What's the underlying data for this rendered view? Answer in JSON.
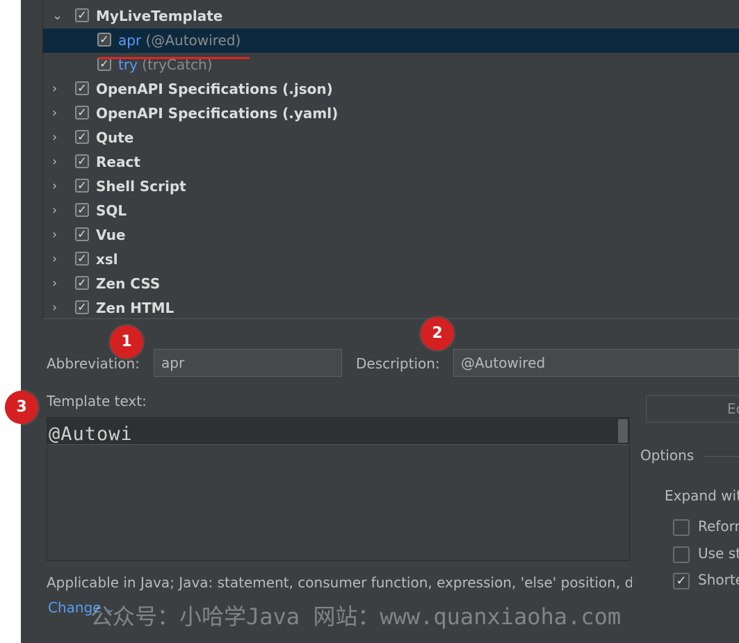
{
  "tree": {
    "rows": [
      {
        "label": "MyLiveTemplate",
        "checked": true,
        "expanded": true
      },
      {
        "abbr": "apr",
        "desc": "(@Autowired)",
        "checked": true,
        "selected": true
      },
      {
        "abbr": "try",
        "desc": "(tryCatch)",
        "checked": true
      },
      {
        "label": "OpenAPI Specifications (.json)",
        "checked": true
      },
      {
        "label": "OpenAPI Specifications (.yaml)",
        "checked": true
      },
      {
        "label": "Qute",
        "checked": true
      },
      {
        "label": "React",
        "checked": true
      },
      {
        "label": "Shell Script",
        "checked": true
      },
      {
        "label": "SQL",
        "checked": true
      },
      {
        "label": "Vue",
        "checked": true
      },
      {
        "label": "xsl",
        "checked": true
      },
      {
        "label": "Zen CSS",
        "checked": true
      },
      {
        "label": "Zen HTML",
        "checked": true
      }
    ]
  },
  "markers": [
    "1",
    "2",
    "3"
  ],
  "form": {
    "abbreviation_label": "Abbreviation:",
    "abbreviation_value": "apr",
    "description_label": "Description:",
    "description_value": "@Autowired",
    "template_label": "Template text:",
    "template_value": "@Autowi",
    "edit_button": "Ec"
  },
  "options": {
    "title": "Options",
    "expand_label": "Expand wit",
    "items": [
      {
        "label": "Reforr",
        "checked": false
      },
      {
        "label": "Use st",
        "checked": false
      },
      {
        "label": "Shorte",
        "checked": true
      }
    ]
  },
  "applicable_text": "Applicable in Java; Java: statement, consumer function, expression, 'else' position, d",
  "change_link": "Change",
  "watermark": "公众号：小哈学Java 网站：www.quanxiaoha.com",
  "colors": {
    "selection": "#0d293e",
    "link": "#589df6",
    "marker": "#d42020",
    "underline": "#e02424"
  }
}
